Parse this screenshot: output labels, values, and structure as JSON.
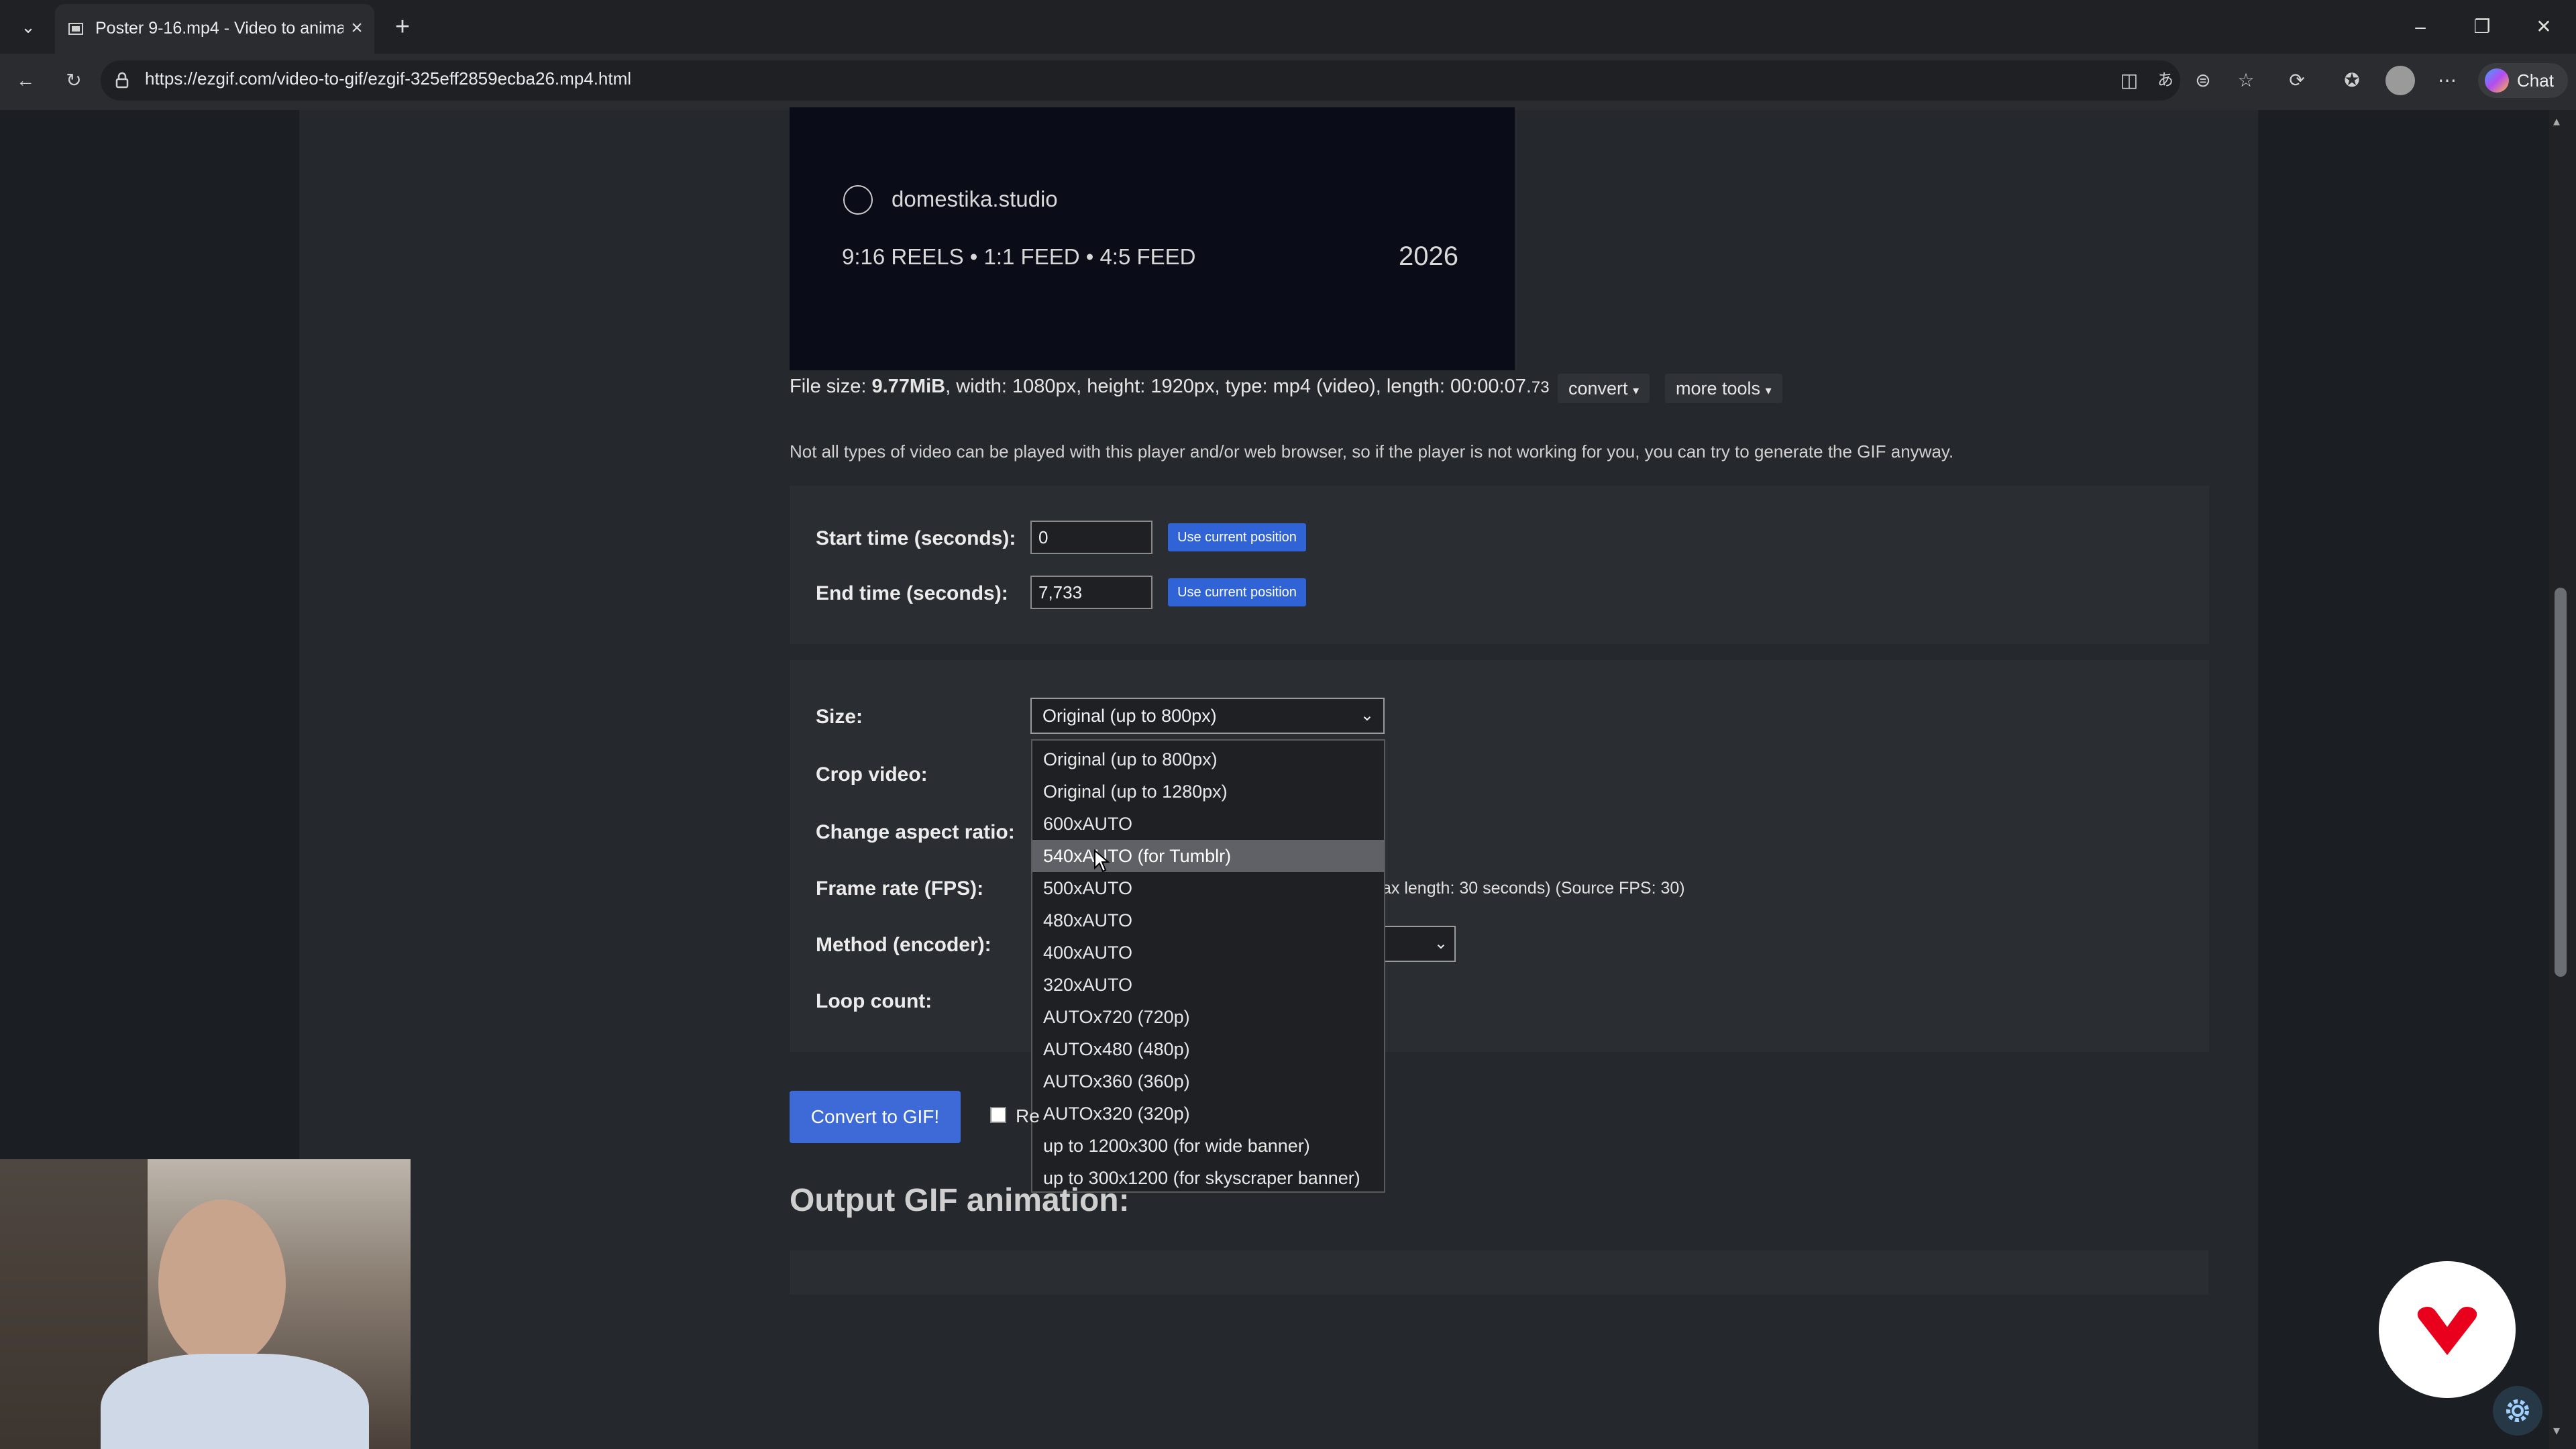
{
  "browser": {
    "tab_title": "Poster 9-16.mp4 - Video to animat",
    "url": "https://ezgif.com/video-to-gif/ezgif-325eff2859ecba26.mp4.html",
    "chat_label": "Chat"
  },
  "video": {
    "brand": "domestika.studio",
    "formats": "9:16 REELS • 1:1 FEED • 4:5 FEED",
    "year": "2026"
  },
  "fileinfo": {
    "prefix": "File size: ",
    "size": "9.77MiB",
    "details": ", width: 1080px, height: 1920px, type: mp4 (video), length: 00:00:07.",
    "length_tail": "73",
    "convert_label": "convert",
    "more_tools_label": "more tools"
  },
  "note": "Not all types of video can be played with this player and/or web browser, so if the player is not working for you, you can try to generate the GIF anyway.",
  "timing": {
    "start_label": "Start time (seconds):",
    "start_value": "0",
    "end_label": "End time (seconds):",
    "end_value": "7,733",
    "use_current_label": "Use current position"
  },
  "options": {
    "size_label": "Size:",
    "size_selected": "Original (up to 800px)",
    "crop_label": "Crop video:",
    "aspect_label": "Change aspect ratio:",
    "fps_label": "Frame rate (FPS):",
    "fps_note": "ax length: 30 seconds) (Source FPS: 30)",
    "method_label": "Method (encoder):",
    "loop_label": "Loop count:"
  },
  "size_options": [
    "Original (up to 800px)",
    "Original (up to 1280px)",
    "600xAUTO",
    "540xAUTO (for Tumblr)",
    "500xAUTO",
    "480xAUTO",
    "400xAUTO",
    "320xAUTO",
    "AUTOx720 (720p)",
    "AUTOx480 (480p)",
    "AUTOx360 (360p)",
    "AUTOx320 (320p)",
    "up to 1200x300 (for wide banner)",
    "up to 300x1200 (for skyscraper banner)"
  ],
  "size_highlighted_index": 3,
  "actions": {
    "convert_label": "Convert to GIF!",
    "checkbox_label_fragment": "Re"
  },
  "output_heading": "Output GIF animation:",
  "colors": {
    "accent": "#3d6ad6",
    "logo_red": "#e8001c"
  },
  "icons": [
    "tabs-dropdown-icon",
    "page-favicon",
    "close-icon",
    "new-tab-icon",
    "minimize-icon",
    "restore-icon",
    "window-close-icon",
    "back-arrow-icon",
    "refresh-icon",
    "site-info-icon",
    "split-screen-icon",
    "translate-icon",
    "reader-icon",
    "favorite-icon",
    "extensions-icon",
    "favorites-list-icon",
    "profile-avatar-icon",
    "more-menu-icon",
    "copilot-icon",
    "settings-gear-icon",
    "domestika-logo-icon"
  ]
}
